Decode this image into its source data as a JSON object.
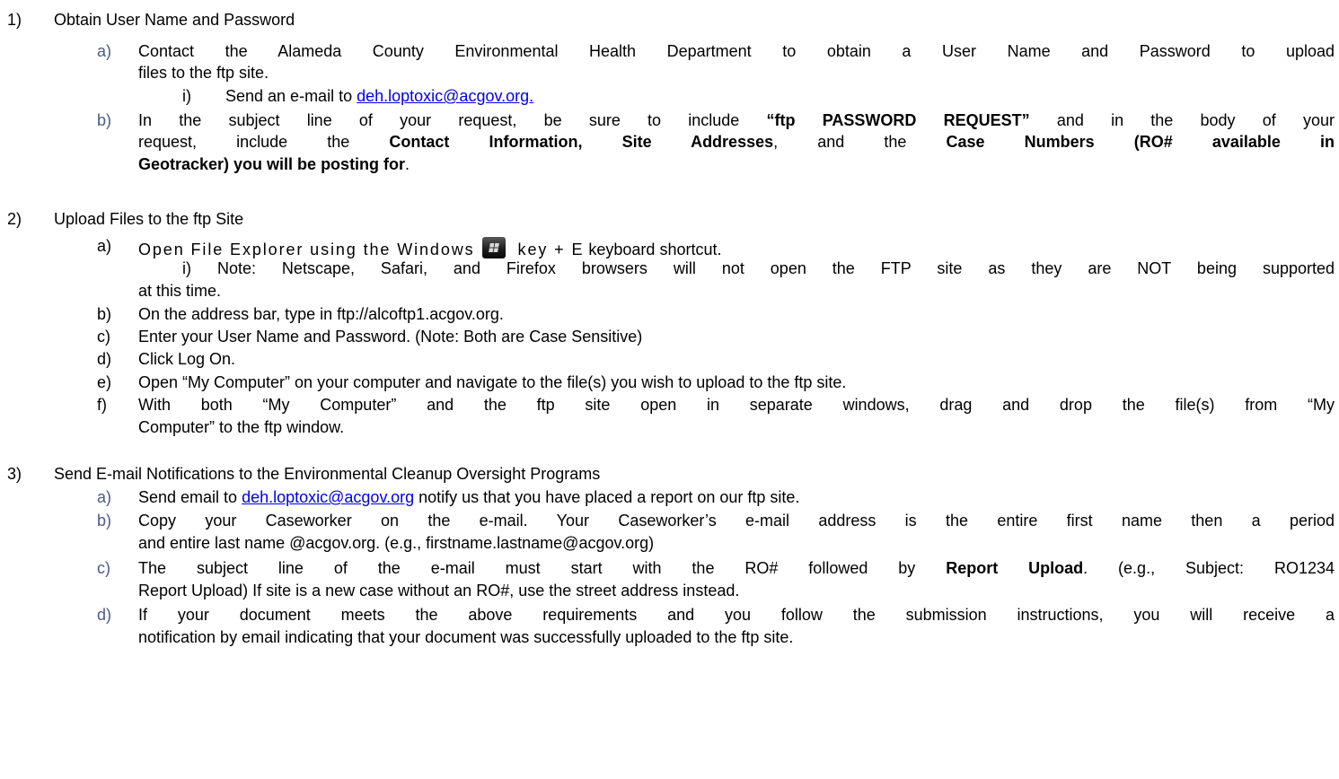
{
  "s1": {
    "num": "1)",
    "title": "Obtain User Name and Password",
    "a": {
      "m": "a)",
      "l1": "Contact the Alameda County Environmental Health Department to obtain a User Name and Password to upload",
      "l2": "files to the ftp site.",
      "i_m": "i)",
      "i_text": "Send an e-mail to ",
      "i_link": "deh.loptoxic@acgov.org."
    },
    "b": {
      "m": "b)",
      "l1_t1": "In the subject line of your request, be sure to include ",
      "l1_b1": "“ftp PASSWORD REQUEST”",
      "l1_t2": " and in the body of your",
      "l2_t1": "request, include the ",
      "l2_b1": "Contact Information, Site Addresses",
      "l2_t2": ", and the ",
      "l2_b2": "Case Numbers (RO# available in",
      "l3_b1": "Geotracker) you will be posting for",
      "l3_t1": "."
    }
  },
  "s2": {
    "num": "2)",
    "title": "Upload Files to the ftp Site",
    "a": {
      "m": "a)",
      "t1": "Open File Explorer using the Windows",
      "icon": "windows-key-icon",
      "t2": "key  + E",
      "t3": " keyboard shortcut.",
      "note1": "i) Note: Netscape, Safari, and Firefox browsers will not open the FTP site as they are NOT being supported",
      "note2": "at this time."
    },
    "b": {
      "m": "b)",
      "text": "On the address bar, type in  ftp://alcoftp1.acgov.org."
    },
    "c": {
      "m": "c)",
      "text": "Enter your User Name and Password. (Note: Both are Case Sensitive)"
    },
    "d": {
      "m": "d)",
      "text": "Click Log On."
    },
    "e": {
      "m": "e)",
      "text": "Open “My Computer” on your computer and navigate to the file(s) you wish to upload to the ftp site."
    },
    "f": {
      "m": "f)",
      "l1": "With both “My Computer” and the ftp site open in separate windows, drag and drop the file(s) from “My",
      "l2": "Computer” to the ftp window."
    }
  },
  "s3": {
    "num": "3)",
    "title": "Send E-mail Notifications to the Environmental Cleanup Oversight Programs",
    "a": {
      "m": "a)",
      "t1": "Send email to ",
      "link": "deh.loptoxic@acgov.org",
      "t2": " notify us that you have placed a report on our ftp site."
    },
    "b": {
      "m": "b)",
      "l1": "Copy your Caseworker on the e-mail.  Your Caseworker’s e-mail address is the entire first name then a period",
      "l2": "and entire last name @acgov.org.  (e.g., firstname.lastname@acgov.org)"
    },
    "c": {
      "m": "c)",
      "l1_t1": "The subject line of the e-mail must start with the RO# followed by ",
      "l1_b1": "Report Upload",
      "l1_t2": ".  (e.g., Subject: RO1234",
      "l2": "Report Upload)  If site is a new case without an RO#, use the street address instead."
    },
    "d": {
      "m": "d)",
      "l1": "If your document meets the above requirements and you follow the submission instructions, you will receive a",
      "l2": "notification by email indicating that your document was successfully uploaded to the ftp site."
    }
  }
}
